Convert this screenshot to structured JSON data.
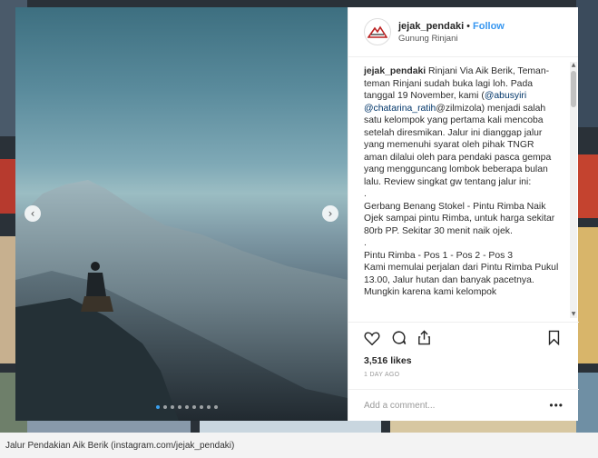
{
  "post": {
    "username": "jejak_pendaki",
    "separator": "•",
    "follow_label": "Follow",
    "location": "Gunung Rinjani",
    "caption": {
      "author": "jejak_pendaki",
      "part1": " Rinjani Via Aik Berik, Teman-teman Rinjani sudah buka lagi loh. Pada tanggal 19 November, kami (",
      "mention1": "@abusyiri",
      "space": " ",
      "mention2": "@chatarina_ratih",
      "part2": "@zilmizola) menjadi salah satu kelompok yang pertama kali mencoba setelah diresmikan. Jalur ini dianggap jalur yang memenuhi syarat oleh pihak TNGR aman dilalui oleh para pendaki pasca gempa yang mengguncang lombok beberapa bulan lalu. Review singkat gw tentang jalur ini:\n.\nGerbang Benang Stokel - Pintu Rimba Naik Ojek sampai pintu Rimba, untuk harga sekitar 80rb PP. Sekitar 30 menit naik ojek.\n.\nPintu Rimba - Pos 1 - Pos 2 - Pos 3\nKami memulai perjalan dari Pintu Rimba Pukul 13.00, Jalur hutan dan banyak pacetnya. Mungkin karena kami kelompok"
    },
    "likes": "3,516 likes",
    "time": "1 DAY AGO",
    "comment_placeholder": "Add a comment...",
    "more_label": "•••",
    "carousel": {
      "slides": 9,
      "active_index": 0
    }
  },
  "icons": {
    "prev": "chevron-left-icon",
    "next": "chevron-right-icon",
    "like": "heart-icon",
    "comment": "comment-icon",
    "share": "share-icon",
    "save": "bookmark-icon"
  },
  "article_caption": "Jalur Pendakian Aik Berik (instagram.com/jejak_pendaki)"
}
